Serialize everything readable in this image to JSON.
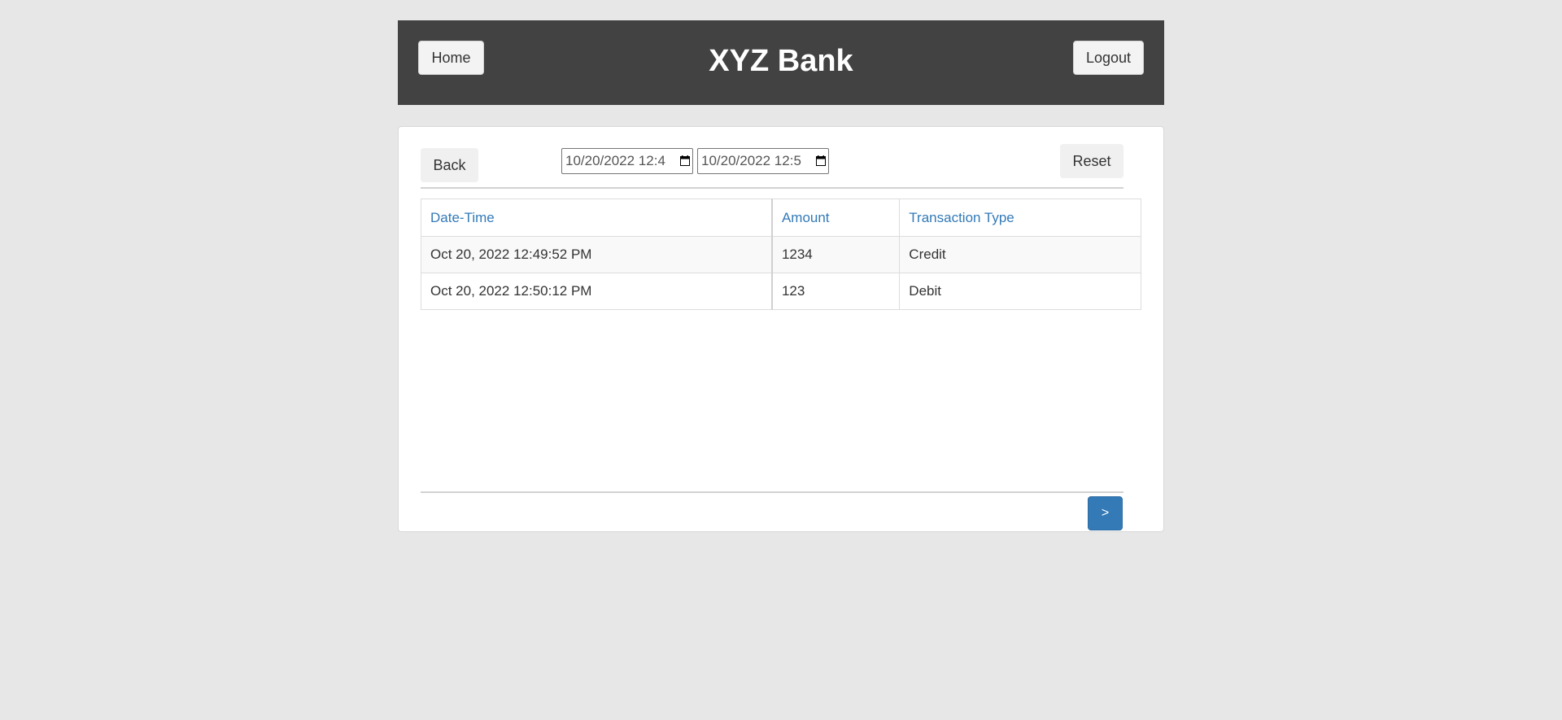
{
  "header": {
    "title": "XYZ Bank",
    "home_label": "Home",
    "logout_label": "Logout"
  },
  "filters": {
    "back_label": "Back",
    "reset_label": "Reset",
    "from_value": "10/20/2022 12:4",
    "to_value": "10/20/2022 12:5"
  },
  "table": {
    "columns": [
      "Date-Time",
      "Amount",
      "Transaction Type"
    ],
    "rows": [
      [
        "Oct 20, 2022 12:49:52 PM",
        "1234",
        "Credit"
      ],
      [
        "Oct 20, 2022 12:50:12 PM",
        "123",
        "Debit"
      ]
    ]
  },
  "pagination": {
    "next_label": ">"
  },
  "colors": {
    "header_bg": "#424242",
    "link_blue": "#337ab7",
    "page_bg": "#e7e7e7"
  }
}
